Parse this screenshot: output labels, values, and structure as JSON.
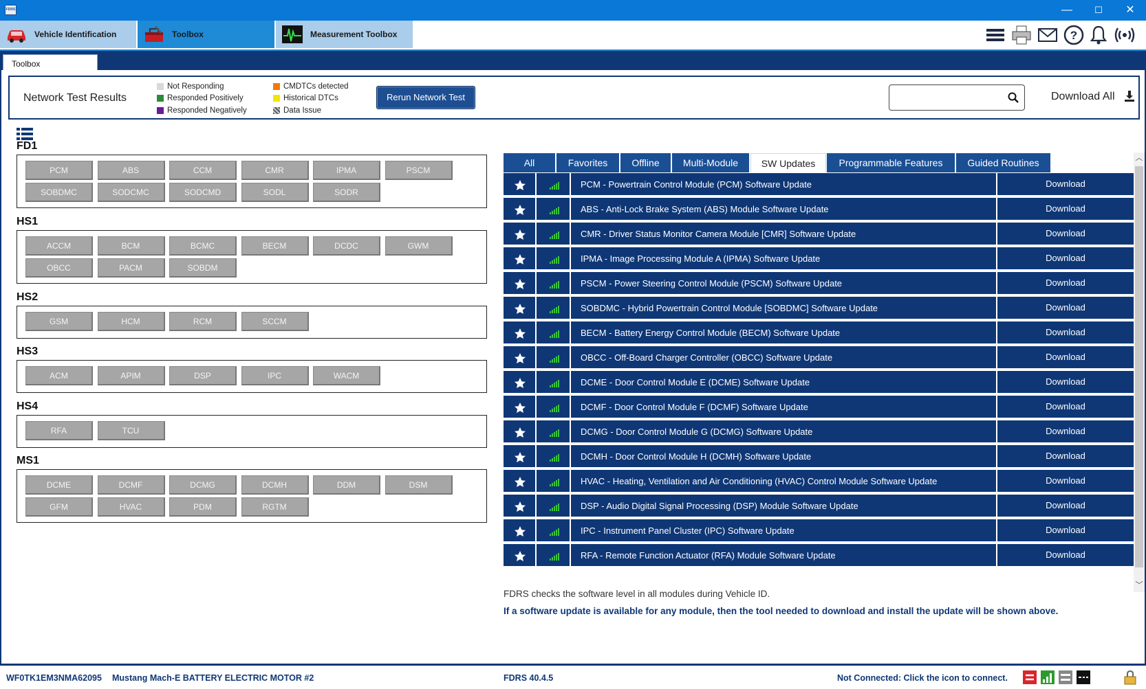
{
  "titlebar": {
    "logo_text": "FDRS",
    "minimize": "—",
    "maximize": "☐",
    "close": "✕"
  },
  "app_tabs": [
    {
      "label": "Vehicle Identification"
    },
    {
      "label": "Toolbox"
    },
    {
      "label": "Measurement Toolbox"
    }
  ],
  "toolbox_tab": "Toolbox",
  "network": {
    "title": "Network Test Results",
    "legend": [
      {
        "label": "Not Responding",
        "color": "#d9d9d9"
      },
      {
        "label": "Responded Positively",
        "color": "#2e8b3a"
      },
      {
        "label": "Responded Negatively",
        "color": "#6a1a9a"
      },
      {
        "label": "CMDTCs detected",
        "color": "#f07a10"
      },
      {
        "label": "Historical DTCs",
        "color": "#f5e400"
      },
      {
        "label": "Data Issue",
        "color": "#8c8c8c"
      }
    ],
    "rerun_label": "Rerun Network Test",
    "search_placeholder": "",
    "download_all": "Download All"
  },
  "groups": [
    {
      "name": "FD1",
      "modules": [
        "PCM",
        "ABS",
        "CCM",
        "CMR",
        "IPMA",
        "PSCM",
        "SOBDMC",
        "SODCMC",
        "SODCMD",
        "SODL",
        "SODR"
      ]
    },
    {
      "name": "HS1",
      "modules": [
        "ACCM",
        "BCM",
        "BCMC",
        "BECM",
        "DCDC",
        "GWM",
        "OBCC",
        "PACM",
        "SOBDM"
      ]
    },
    {
      "name": "HS2",
      "modules": [
        "GSM",
        "HCM",
        "RCM",
        "SCCM"
      ]
    },
    {
      "name": "HS3",
      "modules": [
        "ACM",
        "APIM",
        "DSP",
        "IPC",
        "WACM"
      ]
    },
    {
      "name": "HS4",
      "modules": [
        "RFA",
        "TCU"
      ]
    },
    {
      "name": "MS1",
      "modules": [
        "DCME",
        "DCMF",
        "DCMG",
        "DCMH",
        "DDM",
        "DSM",
        "GFM",
        "HVAC",
        "PDM",
        "RGTM"
      ]
    }
  ],
  "right_tabs": [
    {
      "label": "All"
    },
    {
      "label": "Favorites"
    },
    {
      "label": "Offline"
    },
    {
      "label": "Multi-Module"
    },
    {
      "label": "SW Updates",
      "active": true
    },
    {
      "label": "Programmable Features"
    },
    {
      "label": "Guided Routines"
    }
  ],
  "sw_updates": [
    {
      "desc": "PCM - Powertrain Control Module (PCM) Software Update",
      "action": "Download"
    },
    {
      "desc": "ABS - Anti-Lock Brake System (ABS) Module Software Update",
      "action": "Download"
    },
    {
      "desc": "CMR - Driver Status Monitor Camera Module [CMR] Software Update",
      "action": "Download"
    },
    {
      "desc": "IPMA - Image Processing Module A (IPMA) Software Update",
      "action": "Download"
    },
    {
      "desc": "PSCM - Power Steering Control Module (PSCM) Software Update",
      "action": "Download"
    },
    {
      "desc": "SOBDMC - Hybrid Powertrain Control Module [SOBDMC] Software Update",
      "action": "Download"
    },
    {
      "desc": "BECM - Battery Energy Control Module (BECM) Software Update",
      "action": "Download"
    },
    {
      "desc": "OBCC - Off-Board Charger Controller (OBCC) Software Update",
      "action": "Download"
    },
    {
      "desc": "DCME - Door Control Module E (DCME) Software Update",
      "action": "Download"
    },
    {
      "desc": "DCMF - Door Control Module F (DCMF) Software Update",
      "action": "Download"
    },
    {
      "desc": "DCMG - Door Control Module G (DCMG) Software Update",
      "action": "Download"
    },
    {
      "desc": "DCMH - Door Control Module H (DCMH) Software Update",
      "action": "Download"
    },
    {
      "desc": "HVAC - Heating, Ventilation and Air Conditioning (HVAC) Control Module Software Update",
      "action": "Download"
    },
    {
      "desc": "DSP - Audio Digital Signal Processing (DSP) Module Software Update",
      "action": "Download"
    },
    {
      "desc": "IPC - Instrument Panel Cluster (IPC) Software Update",
      "action": "Download"
    },
    {
      "desc": "RFA - Remote Function Actuator (RFA) Module Software Update",
      "action": "Download"
    }
  ],
  "notes": {
    "line1": "FDRS checks the software level in all modules during Vehicle ID.",
    "line2": "If a software update is available for any module, then the tool needed to download and install the update will be shown above."
  },
  "status": {
    "vin": "WF0TK1EM3NMA62095",
    "vehicle": "Mustang Mach-E BATTERY ELECTRIC MOTOR #2",
    "version": "FDRS 40.4.5",
    "connection": "Not Connected: Click the icon to connect."
  },
  "colors": {
    "navy": "#0f3776",
    "titlebar": "#0a78d7",
    "tab_active": "#1f8ad6",
    "module_grey": "#a6a6a6",
    "signal_green": "#3cc43c"
  }
}
